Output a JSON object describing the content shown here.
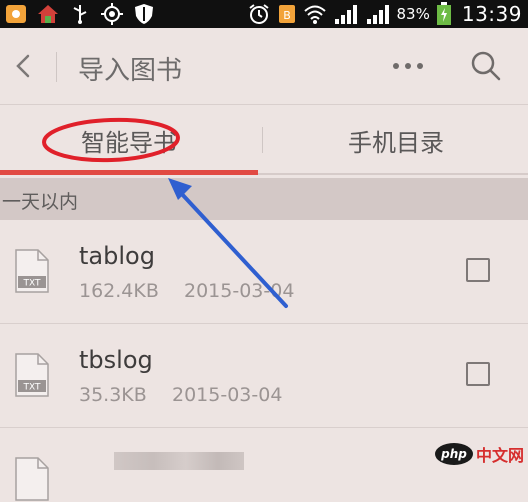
{
  "status_bar": {
    "battery_percent": "83%",
    "time": "13:39",
    "icons": [
      "app-icon",
      "home-icon",
      "usb-icon",
      "gps-icon",
      "shield-icon",
      "alarm-icon",
      "doc-icon",
      "wifi-icon",
      "signal-icon",
      "battery-icon"
    ]
  },
  "header": {
    "title": "导入图书"
  },
  "tabs": [
    {
      "label": "智能导书",
      "active": true
    },
    {
      "label": "手机目录",
      "active": false
    }
  ],
  "section": {
    "label": "一天以内"
  },
  "files": [
    {
      "name": "tablog",
      "size": "162.4KB",
      "date": "2015-03-04",
      "icon_text": "TXT",
      "checked": false
    },
    {
      "name": "tbslog",
      "size": "35.3KB",
      "date": "2015-03-04",
      "icon_text": "TXT",
      "checked": false
    }
  ],
  "watermark": {
    "logo_text": "php",
    "site_text": "中文网"
  },
  "colors": {
    "accent": "#e14a43",
    "background": "#ede4e2",
    "section_bg": "#d3c8c6",
    "annotation_circle": "#e0202a",
    "annotation_arrow": "#2f5fd0"
  }
}
